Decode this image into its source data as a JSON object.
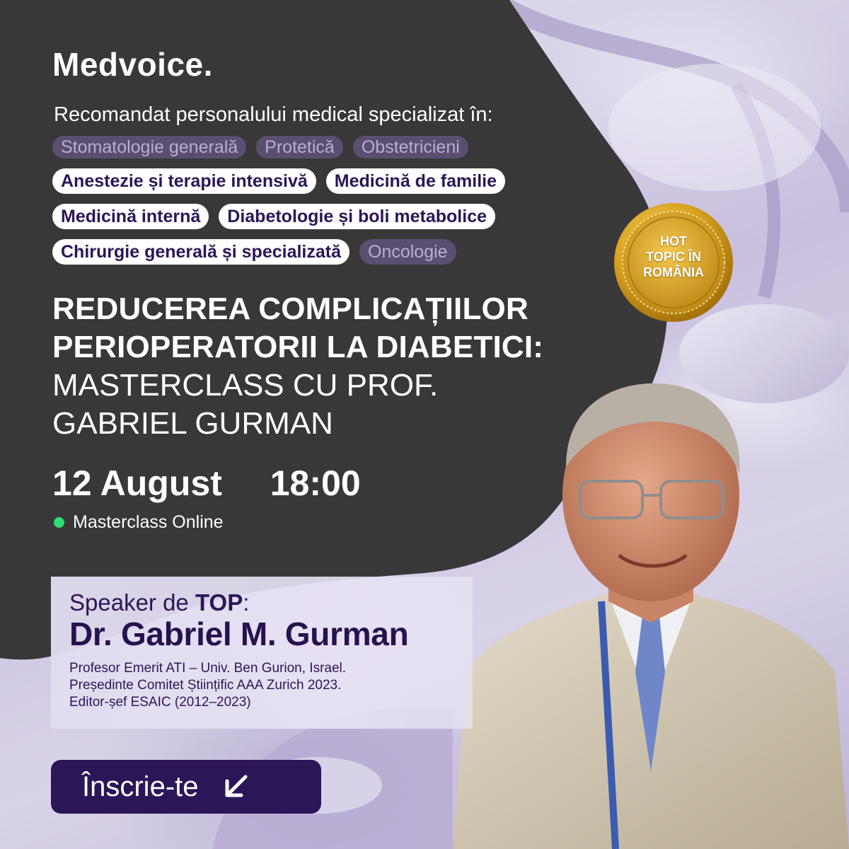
{
  "brand": {
    "logo": "Medvoice."
  },
  "recommendation": {
    "label": "Recomandat personalului medical specializat în:",
    "tags": [
      {
        "label": "Stomatologie generală",
        "active": false
      },
      {
        "label": "Protetică",
        "active": false
      },
      {
        "label": "Obstetricieni",
        "active": false
      },
      {
        "label": "Anestezie și terapie intensivă",
        "active": true
      },
      {
        "label": "Medicină de familie",
        "active": true
      },
      {
        "label": "Medicină internă",
        "active": true
      },
      {
        "label": "Diabetologie și boli metabolice",
        "active": true
      },
      {
        "label": "Chirurgie generală și specializată",
        "active": true
      },
      {
        "label": "Oncologie",
        "active": false
      }
    ]
  },
  "badge": {
    "line1": "HOT",
    "line2": "TOPIC ÎN",
    "line3": "ROMÂNIA"
  },
  "title": {
    "line1": "REDUCEREA COMPLICAȚIILOR",
    "line2": "PERIOPERATORII LA DIABETICI:",
    "line3": "MASTERCLASS CU PROF.",
    "line4": "GABRIEL GURMAN"
  },
  "event": {
    "date": "12 August",
    "time": "18:00",
    "mode": "Masterclass Online"
  },
  "speaker": {
    "label_prefix": "Speaker de ",
    "label_strong": "TOP",
    "label_suffix": ":",
    "name": "Dr. Gabriel M. Gurman",
    "bio": [
      "Profesor Emerit ATI – Univ. Ben Gurion, Israel.",
      "Președinte Comitet Științific AAA Zurich 2023.",
      "Editor-șef ESAIC (2012–2023)"
    ]
  },
  "cta": {
    "label": "Înscrie-te",
    "icon": "arrow-down-left-icon"
  },
  "colors": {
    "dark_panel": "#383838",
    "accent_purple": "#2b1658",
    "online_dot": "#2edc72",
    "badge_gold": "#d9a320"
  }
}
